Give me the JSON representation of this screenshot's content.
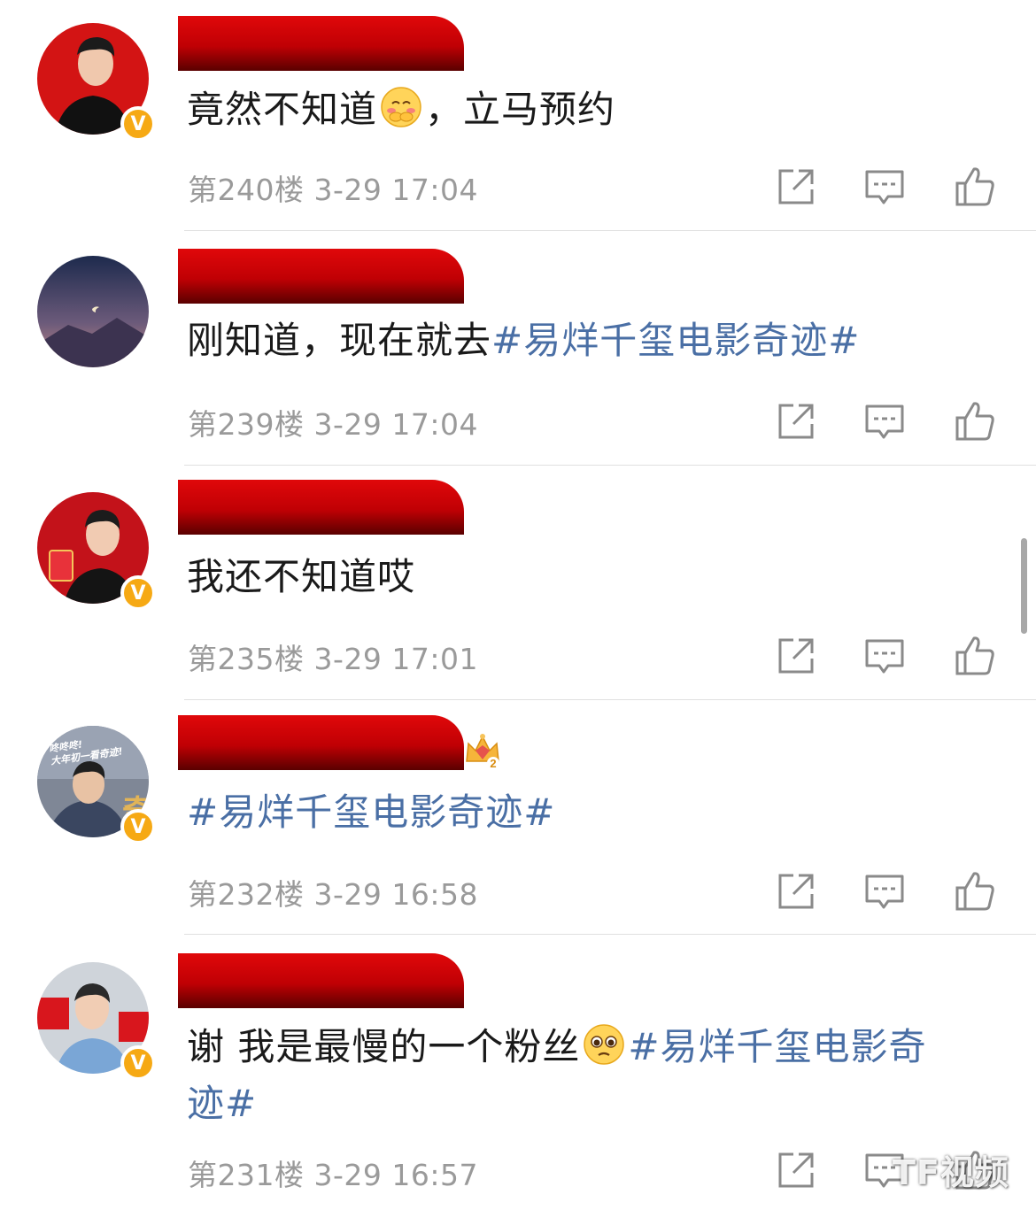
{
  "comments": [
    {
      "text_parts": [
        "竟然不知道",
        "，立马预约"
      ],
      "floor": "第240楼",
      "time": "3-29 17:04"
    },
    {
      "text_parts": [
        "刚知道，现在就去"
      ],
      "hashtag": "#易烊千玺电影奇迹#",
      "floor": "第239楼",
      "time": "3-29 17:04"
    },
    {
      "text_parts": [
        "我还不知道哎"
      ],
      "floor": "第235楼",
      "time": "3-29 17:01"
    },
    {
      "hashtag": "#易烊千玺电影奇迹#",
      "floor": "第232楼",
      "time": "3-29 16:58",
      "avatar_text": [
        "咚咚咚!",
        "大年初一看奇迹!"
      ]
    },
    {
      "text_parts": [
        "谢 我是最慢的一个粉丝"
      ],
      "hashtag_line1": "#易烊千玺电影奇",
      "hashtag_line2": "迹#",
      "floor": "第231楼",
      "time": "3-29 16:57"
    }
  ],
  "verified_badge": "V",
  "crown_level": "2",
  "watermark": "TF视频",
  "colors": {
    "hashtag": "#4a6fa5",
    "meta": "#9a9a9a",
    "verified": "#f6a914",
    "redaction": "#c00004"
  },
  "icons": [
    "share-icon",
    "comment-icon",
    "like-icon"
  ]
}
